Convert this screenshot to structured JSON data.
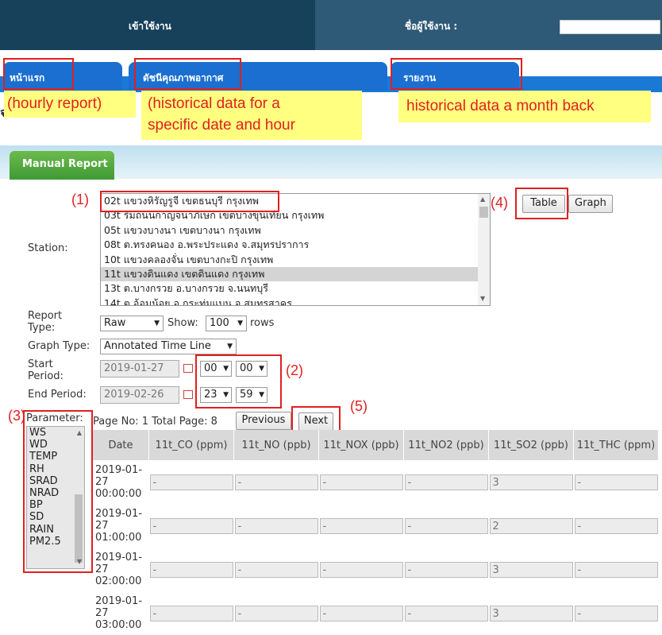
{
  "topbar": {
    "login_label": "เข้าใช้งาน",
    "user_label": "ชื่อผู้ใช้งาน :",
    "user_value": ""
  },
  "tabs": [
    {
      "label": "หน้าแรก"
    },
    {
      "label": "ดัชนีคุณภาพอากาศ"
    },
    {
      "label": "รายงาน"
    }
  ],
  "annotations": {
    "tab1_note": "(hourly report)",
    "tab2_note_line1": "(historical data for a",
    "tab2_note_line2": "specific date and hour",
    "tab3_note": "historical data a month back",
    "n1": "(1)",
    "n2": "(2)",
    "n3": "(3)",
    "n4": "(4)",
    "n5": "(5)"
  },
  "page_subtitle": "จดการผลการตรวจวั",
  "manual_tab_label": "Manual Report",
  "form": {
    "station_label": "Station:",
    "stations": [
      "02t แขวงหิรัญรูจี เขตธนบุรี กรุงเทพ",
      "03t ริมถนนกาญจนาภิเษก เขตบางขุนเทียน กรุงเทพ",
      "05t แขวงบางนา เขตบางนา กรุงเทพ",
      "08t ต.ทรงคนอง อ.พระประแดง จ.สมุทรปราการ",
      "10t แขวงคลองจั่น เขตบางกะปิ กรุงเทพ",
      "11t แขวงดินแดง เขตดินแดง กรุงเทพ",
      "13t ต.บางกรวย อ.บางกรวย จ.นนทบุรี",
      "14t ต.อ้อมน้อย อ.กระทุ่มแบน จ.สมุทรสาคร"
    ],
    "selected_station_index": 5,
    "table_button": "Table",
    "graph_button": "Graph",
    "report_type_label": "Report Type:",
    "report_type_value": "Raw",
    "show_label": "Show:",
    "show_value": "100",
    "rows_label": "rows",
    "graph_type_label": "Graph Type:",
    "graph_type_value": "Annotated Time Line",
    "start_label": "Start Period:",
    "start_date": "2019-01-27",
    "start_hour": "00",
    "start_min": "00",
    "end_label": "End Period:",
    "end_date": "2019-02-26",
    "end_hour": "23",
    "end_min": "59",
    "parameter_label": "Parameter:",
    "parameters": [
      "WS",
      "WD",
      "TEMP",
      "RH",
      "SRAD",
      "NRAD",
      "BP",
      "SD",
      "RAIN",
      "PM2.5"
    ],
    "page_info": "Page No: 1 Total Page: 8",
    "previous_button": "Previous",
    "next_button": "Next"
  },
  "table": {
    "headers": [
      "Date",
      "11t_CO (ppm)",
      "11t_NO (ppb)",
      "11t_NOX (ppb)",
      "11t_NO2 (ppb)",
      "11t_SO2 (ppb)",
      "11t_THC (ppm)"
    ],
    "rows": [
      {
        "date": "2019-01-27 00:00:00",
        "cells": [
          "-",
          "-",
          "-",
          "-",
          "3",
          "-"
        ]
      },
      {
        "date": "2019-01-27 01:00:00",
        "cells": [
          "-",
          "-",
          "-",
          "-",
          "2",
          "-"
        ]
      },
      {
        "date": "2019-01-27 02:00:00",
        "cells": [
          "-",
          "-",
          "-",
          "-",
          "3",
          "-"
        ]
      },
      {
        "date": "2019-01-27 03:00:00",
        "cells": [
          "-",
          "-",
          "-",
          "-",
          "3",
          "-"
        ]
      }
    ]
  }
}
